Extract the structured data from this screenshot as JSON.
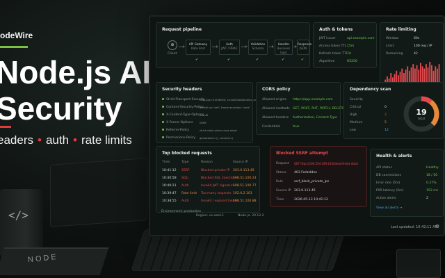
{
  "hero": {
    "brand": "odeWire",
    "title_line1": "Node.js API",
    "title_line2": "Security",
    "tag1": "eaders",
    "tag2": "auth",
    "tag3": "rate limits",
    "dot": "•"
  },
  "desk": {
    "mug_icon": "</>",
    "book_label": "NODE"
  },
  "pipeline": {
    "title": "Request pipeline",
    "client": "Client",
    "stages": [
      {
        "label": "API Gateway",
        "sub": "Rate limit"
      },
      {
        "label": "Auth",
        "sub": "JWT / RBAC"
      },
      {
        "label": "Validation",
        "sub": "Schema"
      },
      {
        "label": "Handler",
        "sub": "Business logic"
      },
      {
        "label": "Response",
        "sub": "JSON"
      }
    ],
    "check": "✔"
  },
  "auth": {
    "title": "Auth & tokens",
    "rows": [
      {
        "k": "JWT issuer",
        "v": "api.example.com"
      },
      {
        "k": "Access token TTL",
        "v": "15m"
      },
      {
        "k": "Refresh token TTL",
        "v": "7d"
      },
      {
        "k": "Algorithm",
        "v": "RS256"
      }
    ]
  },
  "rate": {
    "title": "Rate limiting",
    "rows": [
      {
        "k": "Window",
        "v": "60s"
      },
      {
        "k": "Limit",
        "v": "100 req / IP"
      },
      {
        "k": "Remaining",
        "v": "42"
      }
    ],
    "bars": [
      0.2,
      0.35,
      0.25,
      0.5,
      0.3,
      0.45,
      0.6,
      0.4,
      0.55,
      0.7,
      0.5,
      0.65,
      0.8,
      0.6,
      0.75,
      0.9,
      0.7,
      0.85,
      0.65,
      0.95,
      0.8,
      0.7,
      0.9,
      0.75,
      1.0,
      0.85,
      0.6,
      0.8,
      0.7,
      0.9
    ]
  },
  "headers": {
    "title": "Security headers",
    "rows": [
      {
        "k": "Strict-Transport-Security",
        "v": "max-age=31536000; includeSubDomains; preload"
      },
      {
        "k": "Content-Security-Policy",
        "v": "default-src 'self'; frame-ancestors 'none'"
      },
      {
        "k": "X-Content-Type-Options",
        "v": "nosniff"
      },
      {
        "k": "X-Frame-Options",
        "v": "DENY"
      },
      {
        "k": "Referrer-Policy",
        "v": "strict-origin-when-cross-origin"
      },
      {
        "k": "Permissions-Policy",
        "v": "geolocation=(), camera=()"
      }
    ]
  },
  "cors": {
    "title": "CORS policy",
    "rows": [
      {
        "k": "Allowed origins",
        "v": "https://app.example.com"
      },
      {
        "k": "Allowed methods",
        "v": "GET, POST, PUT, PATCH, DELETE"
      },
      {
        "k": "Allowed headers",
        "v": "Authorization, Content-Type"
      },
      {
        "k": "Credentials",
        "v": "true"
      }
    ]
  },
  "deps": {
    "title": "Dependency scan",
    "rows": [
      {
        "k": "Severity",
        "v": ""
      },
      {
        "k": "Critical",
        "v": "0"
      },
      {
        "k": "High",
        "v": "2"
      },
      {
        "k": "Medium",
        "v": "5"
      },
      {
        "k": "Low",
        "v": "12"
      }
    ],
    "total": "19",
    "total_label": "total",
    "slices": [
      {
        "value": 2,
        "color": "#e5484d"
      },
      {
        "value": 5,
        "color": "#e8893a"
      },
      {
        "value": 12,
        "color": "#2a3330"
      }
    ]
  },
  "blocked": {
    "title": "Top blocked requests",
    "headers": [
      "Time",
      "Type",
      "Reason",
      "Source IP"
    ],
    "rows": [
      {
        "time": "10:41:12",
        "type": "SSRF",
        "reason": "Blocked private IP",
        "ip": "203.0.113.45"
      },
      {
        "time": "10:40:58",
        "type": "SQLi",
        "reason": "Blocked SQL injection",
        "ip": "198.51.100.23"
      },
      {
        "time": "10:40:21",
        "type": "Auth",
        "reason": "Invalid JWT signature",
        "ip": "198.51.100.77"
      },
      {
        "time": "10:39:47",
        "type": "Rate limit",
        "reason": "Too many requests",
        "ip": "192.0.2.101"
      },
      {
        "time": "10:38:55",
        "type": "Auth",
        "reason": "Invalid / expired token",
        "ip": "198.51.100.88"
      }
    ]
  },
  "ssrf": {
    "title": "Blocked SSRF attempt",
    "rows": [
      {
        "k": "Request",
        "v": "GET http://169.254.169.254/latest/meta-data/"
      },
      {
        "k": "Status",
        "v": "403 Forbidden"
      },
      {
        "k": "Rule",
        "v": "ssrf_block_private_ips"
      },
      {
        "k": "Source IP",
        "v": "203.0.113.45"
      },
      {
        "k": "Time",
        "v": "2026-05-13 10:41:12"
      }
    ]
  },
  "health": {
    "title": "Health & alerts",
    "rows": [
      {
        "k": "API status",
        "v": "Healthy"
      },
      {
        "k": "DB connections",
        "v": "18 / 50"
      },
      {
        "k": "Error rate (5m)",
        "v": "0.27%"
      },
      {
        "k": "P95 latency (5m)",
        "v": "152 ms"
      },
      {
        "k": "Active alerts",
        "v": "2"
      }
    ],
    "link": "View all alerts →"
  },
  "footer": {
    "env": "Environment: production",
    "region": "Region: us-east-1",
    "node": "Node.js: 20.12.2",
    "last_updated": "Last updated: 10:42:11 AM",
    "gear": "⚙"
  },
  "colors": {
    "accent_green": "#69c74a",
    "accent_red": "#e5484d",
    "accent_orange": "#e8893a",
    "brand_green": "#7cc144"
  }
}
